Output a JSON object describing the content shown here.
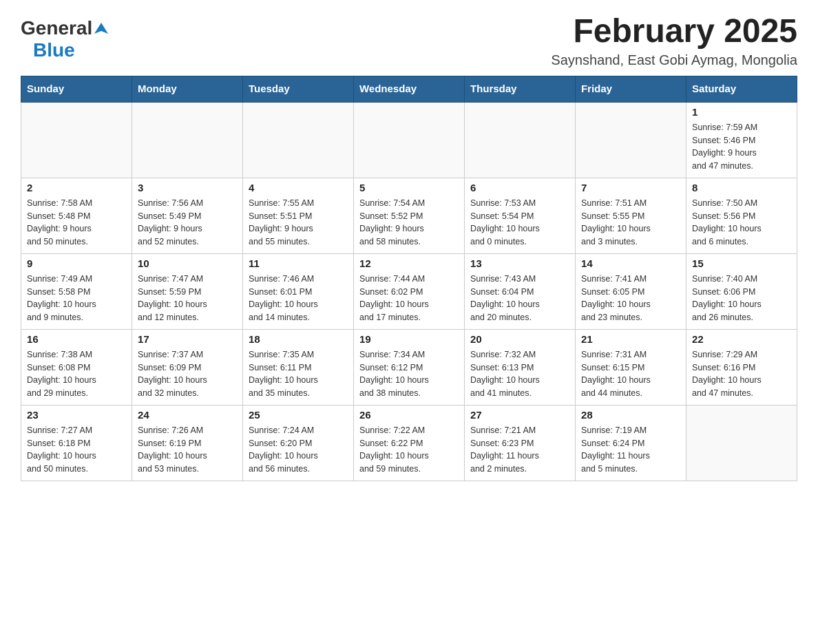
{
  "logo": {
    "general": "General",
    "blue": "Blue"
  },
  "header": {
    "month_year": "February 2025",
    "location": "Saynshand, East Gobi Aymag, Mongolia"
  },
  "weekdays": [
    "Sunday",
    "Monday",
    "Tuesday",
    "Wednesday",
    "Thursday",
    "Friday",
    "Saturday"
  ],
  "weeks": [
    [
      {
        "day": "",
        "info": ""
      },
      {
        "day": "",
        "info": ""
      },
      {
        "day": "",
        "info": ""
      },
      {
        "day": "",
        "info": ""
      },
      {
        "day": "",
        "info": ""
      },
      {
        "day": "",
        "info": ""
      },
      {
        "day": "1",
        "info": "Sunrise: 7:59 AM\nSunset: 5:46 PM\nDaylight: 9 hours\nand 47 minutes."
      }
    ],
    [
      {
        "day": "2",
        "info": "Sunrise: 7:58 AM\nSunset: 5:48 PM\nDaylight: 9 hours\nand 50 minutes."
      },
      {
        "day": "3",
        "info": "Sunrise: 7:56 AM\nSunset: 5:49 PM\nDaylight: 9 hours\nand 52 minutes."
      },
      {
        "day": "4",
        "info": "Sunrise: 7:55 AM\nSunset: 5:51 PM\nDaylight: 9 hours\nand 55 minutes."
      },
      {
        "day": "5",
        "info": "Sunrise: 7:54 AM\nSunset: 5:52 PM\nDaylight: 9 hours\nand 58 minutes."
      },
      {
        "day": "6",
        "info": "Sunrise: 7:53 AM\nSunset: 5:54 PM\nDaylight: 10 hours\nand 0 minutes."
      },
      {
        "day": "7",
        "info": "Sunrise: 7:51 AM\nSunset: 5:55 PM\nDaylight: 10 hours\nand 3 minutes."
      },
      {
        "day": "8",
        "info": "Sunrise: 7:50 AM\nSunset: 5:56 PM\nDaylight: 10 hours\nand 6 minutes."
      }
    ],
    [
      {
        "day": "9",
        "info": "Sunrise: 7:49 AM\nSunset: 5:58 PM\nDaylight: 10 hours\nand 9 minutes."
      },
      {
        "day": "10",
        "info": "Sunrise: 7:47 AM\nSunset: 5:59 PM\nDaylight: 10 hours\nand 12 minutes."
      },
      {
        "day": "11",
        "info": "Sunrise: 7:46 AM\nSunset: 6:01 PM\nDaylight: 10 hours\nand 14 minutes."
      },
      {
        "day": "12",
        "info": "Sunrise: 7:44 AM\nSunset: 6:02 PM\nDaylight: 10 hours\nand 17 minutes."
      },
      {
        "day": "13",
        "info": "Sunrise: 7:43 AM\nSunset: 6:04 PM\nDaylight: 10 hours\nand 20 minutes."
      },
      {
        "day": "14",
        "info": "Sunrise: 7:41 AM\nSunset: 6:05 PM\nDaylight: 10 hours\nand 23 minutes."
      },
      {
        "day": "15",
        "info": "Sunrise: 7:40 AM\nSunset: 6:06 PM\nDaylight: 10 hours\nand 26 minutes."
      }
    ],
    [
      {
        "day": "16",
        "info": "Sunrise: 7:38 AM\nSunset: 6:08 PM\nDaylight: 10 hours\nand 29 minutes."
      },
      {
        "day": "17",
        "info": "Sunrise: 7:37 AM\nSunset: 6:09 PM\nDaylight: 10 hours\nand 32 minutes."
      },
      {
        "day": "18",
        "info": "Sunrise: 7:35 AM\nSunset: 6:11 PM\nDaylight: 10 hours\nand 35 minutes."
      },
      {
        "day": "19",
        "info": "Sunrise: 7:34 AM\nSunset: 6:12 PM\nDaylight: 10 hours\nand 38 minutes."
      },
      {
        "day": "20",
        "info": "Sunrise: 7:32 AM\nSunset: 6:13 PM\nDaylight: 10 hours\nand 41 minutes."
      },
      {
        "day": "21",
        "info": "Sunrise: 7:31 AM\nSunset: 6:15 PM\nDaylight: 10 hours\nand 44 minutes."
      },
      {
        "day": "22",
        "info": "Sunrise: 7:29 AM\nSunset: 6:16 PM\nDaylight: 10 hours\nand 47 minutes."
      }
    ],
    [
      {
        "day": "23",
        "info": "Sunrise: 7:27 AM\nSunset: 6:18 PM\nDaylight: 10 hours\nand 50 minutes."
      },
      {
        "day": "24",
        "info": "Sunrise: 7:26 AM\nSunset: 6:19 PM\nDaylight: 10 hours\nand 53 minutes."
      },
      {
        "day": "25",
        "info": "Sunrise: 7:24 AM\nSunset: 6:20 PM\nDaylight: 10 hours\nand 56 minutes."
      },
      {
        "day": "26",
        "info": "Sunrise: 7:22 AM\nSunset: 6:22 PM\nDaylight: 10 hours\nand 59 minutes."
      },
      {
        "day": "27",
        "info": "Sunrise: 7:21 AM\nSunset: 6:23 PM\nDaylight: 11 hours\nand 2 minutes."
      },
      {
        "day": "28",
        "info": "Sunrise: 7:19 AM\nSunset: 6:24 PM\nDaylight: 11 hours\nand 5 minutes."
      },
      {
        "day": "",
        "info": ""
      }
    ]
  ]
}
